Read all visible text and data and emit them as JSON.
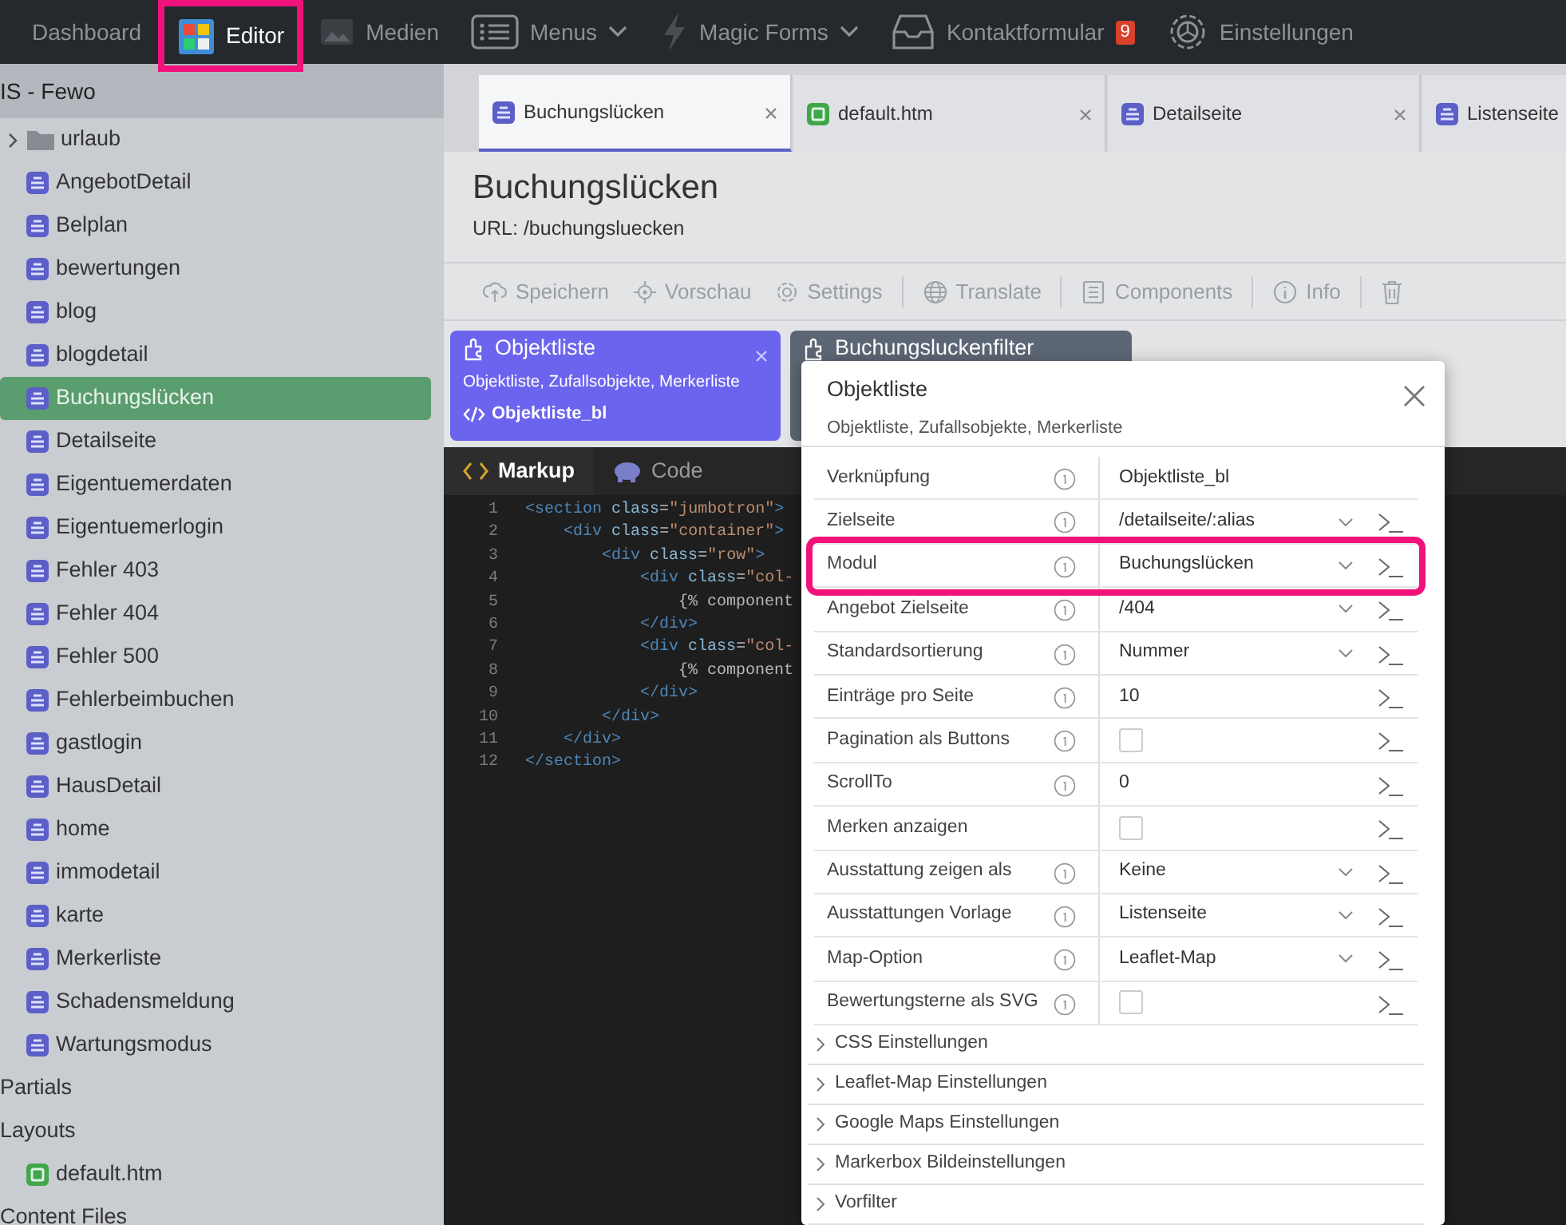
{
  "nav": [
    {
      "label": "Dashboard",
      "selected": false,
      "annotated": false
    },
    {
      "label": "Editor",
      "selected": true,
      "annotated": true
    },
    {
      "label": "Medien",
      "selected": false,
      "annotated": false
    },
    {
      "label": "Menus",
      "selected": false,
      "annotated": false,
      "dropdown": true
    },
    {
      "label": "Magic Forms",
      "selected": false,
      "annotated": false,
      "dropdown": true
    },
    {
      "label": "Kontaktformular",
      "selected": false,
      "annotated": false,
      "badge": "9"
    },
    {
      "label": "Einstellungen",
      "selected": false,
      "annotated": false
    }
  ],
  "sidebar": {
    "title": "IS - Fewo",
    "items": [
      {
        "kind": "folder",
        "label": "urlaub",
        "expanded": false,
        "selected": false
      },
      {
        "kind": "page",
        "label": "AngebotDetail",
        "selected": false
      },
      {
        "kind": "page",
        "label": "Belplan",
        "selected": false
      },
      {
        "kind": "page",
        "label": "bewertungen",
        "selected": false
      },
      {
        "kind": "page",
        "label": "blog",
        "selected": false
      },
      {
        "kind": "page",
        "label": "blogdetail",
        "selected": false
      },
      {
        "kind": "page",
        "label": "Buchungslücken",
        "selected": true
      },
      {
        "kind": "page",
        "label": "Detailseite",
        "selected": false
      },
      {
        "kind": "page",
        "label": "Eigentuemerdaten",
        "selected": false
      },
      {
        "kind": "page",
        "label": "Eigentuemerlogin",
        "selected": false
      },
      {
        "kind": "page",
        "label": "Fehler 403",
        "selected": false
      },
      {
        "kind": "page",
        "label": "Fehler 404",
        "selected": false
      },
      {
        "kind": "page",
        "label": "Fehler 500",
        "selected": false
      },
      {
        "kind": "page",
        "label": "Fehlerbeimbuchen",
        "selected": false
      },
      {
        "kind": "page",
        "label": "gastlogin",
        "selected": false
      },
      {
        "kind": "page",
        "label": "HausDetail",
        "selected": false
      },
      {
        "kind": "page",
        "label": "home",
        "selected": false
      },
      {
        "kind": "page",
        "label": "immodetail",
        "selected": false
      },
      {
        "kind": "page",
        "label": "karte",
        "selected": false
      },
      {
        "kind": "page",
        "label": "Merkerliste",
        "selected": false
      },
      {
        "kind": "page",
        "label": "Schadensmeldung",
        "selected": false
      },
      {
        "kind": "page",
        "label": "Wartungsmodus",
        "selected": false
      },
      {
        "kind": "section",
        "label": "Partials"
      },
      {
        "kind": "section",
        "label": "Layouts",
        "children": [
          {
            "kind": "layout",
            "label": "default.htm",
            "selected": false
          }
        ]
      },
      {
        "kind": "section",
        "label": "Content Files"
      }
    ]
  },
  "tabs": [
    {
      "kind": "page",
      "label": "Buchungslücken",
      "selected": true,
      "close_button": true
    },
    {
      "kind": "layout",
      "label": "default.htm",
      "selected": false,
      "close_button": true
    },
    {
      "kind": "page",
      "label": "Detailseite",
      "selected": false,
      "close_button": true
    },
    {
      "kind": "page",
      "label": "Listenseite",
      "selected": false,
      "close_button": false
    }
  ],
  "page": {
    "title": "Buchungslücken",
    "url": "URL: /buchungsluecken"
  },
  "toolbar": [
    {
      "label": "Speichern"
    },
    {
      "label": "Vorschau"
    },
    {
      "label": "Settings"
    },
    {
      "label": "Translate"
    },
    {
      "label": "Components"
    },
    {
      "label": "Info"
    }
  ],
  "components": [
    {
      "title": "Objektliste",
      "description": "Objektliste, Zufallsobjekte, Merkerliste",
      "alias": "Objektliste_bl",
      "selected": true
    },
    {
      "title": "Buchungsluckenfilter",
      "selected": false
    }
  ],
  "editor_tabs": [
    {
      "label": "Markup",
      "selected": true
    },
    {
      "label": "Code",
      "selected": false
    }
  ],
  "code_lines": [
    {
      "number": "1",
      "text": "<section class=\"jumbotron\">"
    },
    {
      "number": "2",
      "text": "    <div class=\"container\">"
    },
    {
      "number": "3",
      "text": "        <div class=\"row\">"
    },
    {
      "number": "4",
      "text": "            <div class=\"col-"
    },
    {
      "number": "5",
      "text": "                {% component"
    },
    {
      "number": "6",
      "text": "            </div>"
    },
    {
      "number": "7",
      "text": "            <div class=\"col-"
    },
    {
      "number": "8",
      "text": "                {% component"
    },
    {
      "number": "9",
      "text": "            </div>"
    },
    {
      "number": "10",
      "text": "        </div>"
    },
    {
      "number": "11",
      "text": "    </div>"
    },
    {
      "number": "12",
      "text": "</section>"
    }
  ],
  "popover": {
    "title": "Objektliste",
    "subtitle": "Objektliste, Zufallsobjekte, Merkerliste",
    "properties": [
      {
        "label": "Verknüpfung",
        "info": true,
        "kind": "text",
        "value": "Objektliste_bl",
        "terminal": false,
        "annotated": false
      },
      {
        "label": "Zielseite",
        "info": true,
        "kind": "select",
        "value": "/detailseite/:alias",
        "terminal": true,
        "annotated": false
      },
      {
        "label": "Modul",
        "info": true,
        "kind": "select",
        "value": "Buchungslücken",
        "terminal": true,
        "annotated": true
      },
      {
        "label": "Angebot Zielseite",
        "info": true,
        "kind": "select",
        "value": "/404",
        "terminal": true,
        "annotated": false
      },
      {
        "label": "Standardsortierung",
        "info": true,
        "kind": "select",
        "value": "Nummer",
        "terminal": true,
        "annotated": false
      },
      {
        "label": "Einträge pro Seite",
        "info": true,
        "kind": "text",
        "value": "10",
        "terminal": true,
        "annotated": false
      },
      {
        "label": "Pagination als Buttons",
        "info": true,
        "kind": "checkbox",
        "checked": false,
        "terminal": true,
        "annotated": false
      },
      {
        "label": "ScrollTo",
        "info": true,
        "kind": "text",
        "value": "0",
        "terminal": true,
        "annotated": false
      },
      {
        "label": "Merken anzaigen",
        "info": false,
        "kind": "checkbox",
        "checked": false,
        "terminal": true,
        "annotated": false
      },
      {
        "label": "Ausstattung zeigen als",
        "info": true,
        "kind": "select",
        "value": "Keine",
        "terminal": true,
        "annotated": false
      },
      {
        "label": "Ausstattungen Vorlage",
        "info": true,
        "kind": "select",
        "value": "Listenseite",
        "terminal": true,
        "annotated": false
      },
      {
        "label": "Map-Option",
        "info": true,
        "kind": "select",
        "value": "Leaflet-Map",
        "terminal": true,
        "annotated": false
      },
      {
        "label": "Bewertungsterne als SVG",
        "info": true,
        "kind": "checkbox",
        "checked": false,
        "terminal": true,
        "annotated": false
      }
    ],
    "sections": [
      {
        "label": "CSS Einstellungen",
        "expanded": false
      },
      {
        "label": "Leaflet-Map Einstellungen",
        "expanded": false
      },
      {
        "label": "Google Maps Einstellungen",
        "expanded": false
      },
      {
        "label": "Markerbox Bildeinstellungen",
        "expanded": false
      },
      {
        "label": "Vorfilter",
        "expanded": false
      }
    ]
  }
}
